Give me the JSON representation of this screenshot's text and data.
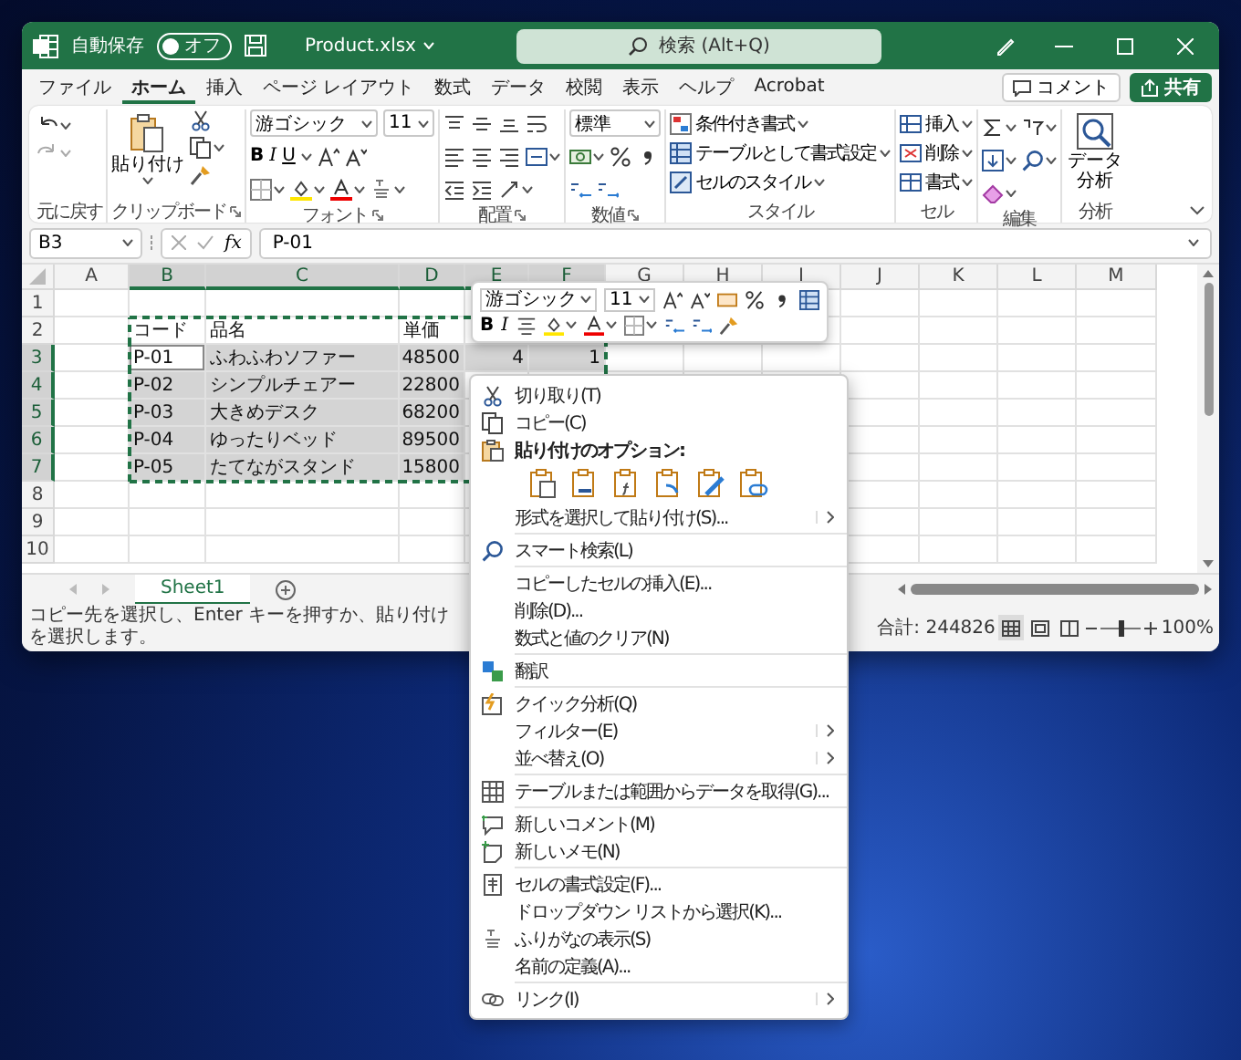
{
  "window": {
    "autosave_label": "自動保存",
    "autosave": {
      "on": false,
      "label": "オフ"
    },
    "file_name": "Product.xlsx",
    "search_placeholder": "検索 (Alt+Q)"
  },
  "ribbon_tabs": [
    {
      "label": "ファイル",
      "selected": false
    },
    {
      "label": "ホーム",
      "selected": true
    },
    {
      "label": "挿入",
      "selected": false
    },
    {
      "label": "ページ レイアウト",
      "selected": false
    },
    {
      "label": "数式",
      "selected": false
    },
    {
      "label": "データ",
      "selected": false
    },
    {
      "label": "校閲",
      "selected": false
    },
    {
      "label": "表示",
      "selected": false
    },
    {
      "label": "ヘルプ",
      "selected": false
    },
    {
      "label": "Acrobat",
      "selected": false
    }
  ],
  "comment_button": "コメント",
  "share_button": "共有",
  "ribbon": {
    "undo": {
      "label": "元に戻す"
    },
    "clipboard": {
      "label": "クリップボード",
      "paste": "貼り付け"
    },
    "font": {
      "label": "フォント",
      "font_name": "游ゴシック",
      "font_size": "11",
      "bold": "B",
      "italic": "I",
      "underline": "U"
    },
    "alignment": {
      "label": "配置"
    },
    "number": {
      "label": "数値",
      "format": "標準"
    },
    "styles": {
      "label": "スタイル",
      "items": [
        "条件付き書式",
        "テーブルとして書式設定",
        "セルのスタイル"
      ]
    },
    "cells": {
      "label": "セル",
      "items": [
        "挿入",
        "削除",
        "書式"
      ]
    },
    "editing": {
      "label": "編集"
    },
    "analysis": {
      "label": "分析",
      "button": "データ分析"
    }
  },
  "formula_bar": {
    "name_box": "B3",
    "fx": "fx",
    "formula": "P-01"
  },
  "columns": [
    {
      "label": "A",
      "selected": false,
      "copied": false
    },
    {
      "label": "B",
      "selected": true,
      "copied": true
    },
    {
      "label": "C",
      "selected": true,
      "copied": true
    },
    {
      "label": "D",
      "selected": true,
      "copied": true
    },
    {
      "label": "E",
      "selected": true,
      "copied": true
    },
    {
      "label": "F",
      "selected": true,
      "copied": true
    },
    {
      "label": "G",
      "selected": false,
      "copied": false
    },
    {
      "label": "H",
      "selected": false,
      "copied": false
    },
    {
      "label": "I",
      "selected": false,
      "copied": false
    },
    {
      "label": "J",
      "selected": false,
      "copied": false
    },
    {
      "label": "K",
      "selected": false,
      "copied": false
    },
    {
      "label": "L",
      "selected": false,
      "copied": false
    },
    {
      "label": "M",
      "selected": false,
      "copied": false
    }
  ],
  "rows": [
    {
      "label": "1",
      "selected": false,
      "copied": false,
      "cells": []
    },
    {
      "label": "2",
      "selected": false,
      "copied": true,
      "cells": [
        {
          "kind": "text",
          "text": "コード"
        },
        {
          "kind": "text",
          "text": "品名"
        },
        {
          "kind": "text",
          "text": "単価"
        }
      ]
    },
    {
      "label": "3",
      "selected": true,
      "copied": true,
      "cells": [
        {
          "kind": "text",
          "text": "P-01",
          "active": true
        },
        {
          "kind": "text",
          "text": "ふわふわソファー",
          "active": false
        },
        {
          "kind": "number",
          "text": "48500",
          "active": false
        },
        {
          "kind": "number",
          "text": "4",
          "active": false
        },
        {
          "kind": "number",
          "text": "1",
          "active": false
        }
      ]
    },
    {
      "label": "4",
      "selected": true,
      "copied": true,
      "cells": [
        {
          "kind": "text",
          "text": "P-02",
          "active": false
        },
        {
          "kind": "text",
          "text": "シンプルチェアー",
          "active": false
        },
        {
          "kind": "number",
          "text": "22800",
          "active": false
        }
      ]
    },
    {
      "label": "5",
      "selected": true,
      "copied": true,
      "cells": [
        {
          "kind": "text",
          "text": "P-03",
          "active": false
        },
        {
          "kind": "text",
          "text": "大きめデスク",
          "active": false
        },
        {
          "kind": "number",
          "text": "68200",
          "active": false
        }
      ]
    },
    {
      "label": "6",
      "selected": true,
      "copied": true,
      "cells": [
        {
          "kind": "text",
          "text": "P-04",
          "active": false
        },
        {
          "kind": "text",
          "text": "ゆったりベッド",
          "active": false
        },
        {
          "kind": "number",
          "text": "89500",
          "active": false
        }
      ]
    },
    {
      "label": "7",
      "selected": true,
      "copied": true,
      "cells": [
        {
          "kind": "text",
          "text": "P-05",
          "active": false
        },
        {
          "kind": "text",
          "text": "たてながスタンド",
          "active": false
        },
        {
          "kind": "number",
          "text": "15800",
          "active": false
        }
      ]
    },
    {
      "label": "8",
      "selected": false,
      "copied": false,
      "cells": []
    },
    {
      "label": "9",
      "selected": false,
      "copied": false,
      "cells": []
    },
    {
      "label": "10",
      "selected": false,
      "copied": false,
      "cells": []
    }
  ],
  "sheet_tabs": [
    {
      "label": "Sheet1",
      "selected": true
    }
  ],
  "status_bar": {
    "message": "コピー先を選択し、Enter キーを押すか、貼り付けを選択します。",
    "sum": "合計: 244826",
    "views": [
      {
        "selected": true
      },
      {
        "selected": false
      },
      {
        "selected": false
      }
    ],
    "zoom_slider": {
      "level": 0.5
    },
    "zoom": "100%"
  },
  "mini_toolbar": {
    "font_name": "游ゴシック",
    "font_size": "11",
    "bold": "B",
    "italic": "I"
  },
  "context_menu": [
    {
      "kind": "item",
      "label": "切り取り(T)",
      "submenu": false
    },
    {
      "kind": "item",
      "label": "コピー(C)",
      "submenu": false
    },
    {
      "kind": "header",
      "label": "貼り付けのオプション:"
    },
    {
      "kind": "paste_options"
    },
    {
      "kind": "item",
      "label": "形式を選択して貼り付け(S)...",
      "submenu": true
    },
    {
      "kind": "separator"
    },
    {
      "kind": "item",
      "label": "スマート検索(L)",
      "submenu": false
    },
    {
      "kind": "separator"
    },
    {
      "kind": "item",
      "label": "コピーしたセルの挿入(E)...",
      "submenu": false
    },
    {
      "kind": "item",
      "label": "削除(D)...",
      "submenu": false
    },
    {
      "kind": "item",
      "label": "数式と値のクリア(N)",
      "submenu": false
    },
    {
      "kind": "separator"
    },
    {
      "kind": "item",
      "label": "翻訳",
      "submenu": false
    },
    {
      "kind": "separator"
    },
    {
      "kind": "item",
      "label": "クイック分析(Q)",
      "submenu": false
    },
    {
      "kind": "item",
      "label": "フィルター(E)",
      "submenu": true
    },
    {
      "kind": "item",
      "label": "並べ替え(O)",
      "submenu": true
    },
    {
      "kind": "separator"
    },
    {
      "kind": "item",
      "label": "テーブルまたは範囲からデータを取得(G)...",
      "submenu": false
    },
    {
      "kind": "separator"
    },
    {
      "kind": "item",
      "label": "新しいコメント(M)",
      "submenu": false
    },
    {
      "kind": "item",
      "label": "新しいメモ(N)",
      "submenu": false
    },
    {
      "kind": "separator"
    },
    {
      "kind": "item",
      "label": "セルの書式設定(F)...",
      "submenu": false
    },
    {
      "kind": "item",
      "label": "ドロップダウン リストから選択(K)...",
      "submenu": false
    },
    {
      "kind": "item",
      "label": "ふりがなの表示(S)",
      "submenu": false
    },
    {
      "kind": "item",
      "label": "名前の定義(A)...",
      "submenu": false
    },
    {
      "kind": "separator"
    },
    {
      "kind": "item",
      "label": "リンク(I)",
      "submenu": true
    }
  ]
}
